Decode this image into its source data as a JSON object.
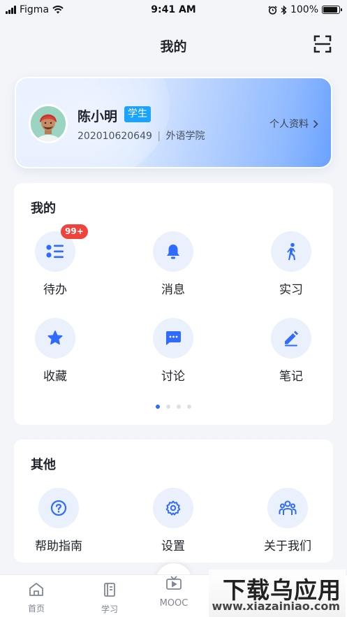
{
  "status_bar": {
    "carrier": "Figma",
    "time": "9:41 AM",
    "battery": "100%"
  },
  "header": {
    "title": "我的"
  },
  "profile": {
    "name": "陈小明",
    "role": "学生",
    "student_id": "202010620649",
    "separator": "|",
    "college": "外语学院",
    "link_label": "个人资料"
  },
  "mine": {
    "title": "我的",
    "items": [
      {
        "label": "待办",
        "icon": "todo-list-icon",
        "badge": "99+"
      },
      {
        "label": "消息",
        "icon": "bell-icon"
      },
      {
        "label": "实习",
        "icon": "walking-person-icon"
      },
      {
        "label": "收藏",
        "icon": "star-icon"
      },
      {
        "label": "讨论",
        "icon": "chat-bubble-icon"
      },
      {
        "label": "笔记",
        "icon": "pencil-icon"
      }
    ],
    "pagination": {
      "pages": 4,
      "current": 1
    }
  },
  "other": {
    "title": "其他",
    "items": [
      {
        "label": "帮助指南",
        "icon": "help-icon"
      },
      {
        "label": "设置",
        "icon": "gear-icon"
      },
      {
        "label": "关于我们",
        "icon": "people-icon"
      }
    ]
  },
  "tab_bar": {
    "tabs": [
      {
        "label": "首页",
        "icon": "home-icon"
      },
      {
        "label": "学习",
        "icon": "book-icon"
      },
      {
        "label": "MOOC",
        "icon": "tv-icon"
      }
    ]
  },
  "watermark": {
    "text": "下载乌应用",
    "url": "www.xiazainiao.com"
  },
  "colors": {
    "accent": "#2f6bff",
    "icon_bg": "#eaf1fd",
    "badge": "#f0433b",
    "role_badge": "#1aa3ff",
    "page_bg": "#f3f5f9"
  }
}
